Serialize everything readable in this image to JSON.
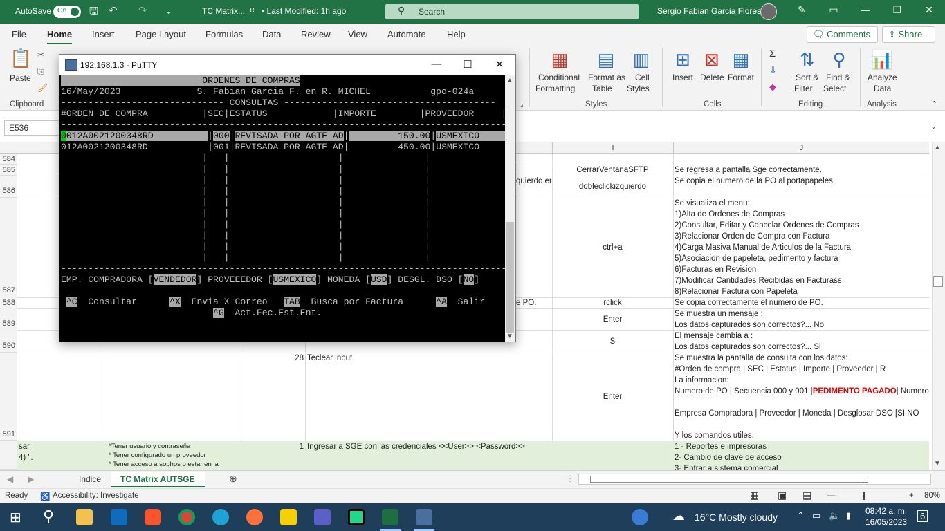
{
  "titlebar": {
    "autosave_label": "AutoSave",
    "autosave_state": "On",
    "doc_title": "TC Matrix...",
    "modified": "• Last Modified: 1h ago",
    "search_placeholder": "Search",
    "user": "Sergio Fabian Garcia Flores"
  },
  "tabs": [
    "File",
    "Home",
    "Insert",
    "Page Layout",
    "Formulas",
    "Data",
    "Review",
    "View",
    "Automate",
    "Help"
  ],
  "ribbon_buttons": {
    "comments": "Comments",
    "share": "Share"
  },
  "ribbon": {
    "paste": "Paste",
    "clipboard": "Clipboard",
    "cond_fmt_1": "Conditional",
    "cond_fmt_2": "Formatting",
    "format_table_1": "Format as",
    "format_table_2": "Table",
    "cell_styles_1": "Cell",
    "cell_styles_2": "Styles",
    "styles_group": "Styles",
    "insert": "Insert",
    "delete": "Delete",
    "format": "Format",
    "cells_group": "Cells",
    "sort_1": "Sort &",
    "sort_2": "Filter",
    "find_1": "Find &",
    "find_2": "Select",
    "editing_group": "Editing",
    "analyze_1": "Analyze",
    "analyze_2": "Data",
    "analysis_group": "Analysis"
  },
  "name_box": "E536",
  "grid": {
    "col_i": "I",
    "col_j": "J",
    "rows": {
      "r584": "584",
      "r585": "585",
      "r586": "586",
      "r587": "587",
      "r588": "588",
      "r589": "589",
      "r590": "590",
      "r591": "591"
    },
    "c585_i": "CerrarVentanaSFTP",
    "c585_j": "Se regresa a pantalla Sge correctamente.",
    "c586_h": "quierdo en",
    "c586_i": "dobleclickizquierdo",
    "c586_j": "Se copia el numero de la PO al portapapeles.",
    "c587_i": "ctrl+a",
    "c587_j": [
      "Se visualiza el menu:",
      "1)Alta de Ordenes de Compras",
      "2)Consultar, Editar y Cancelar Ordenes de Compras",
      "3)Relacionar Orden de Compra con Factura",
      "4)Carga Masiva Manual de Articulos de la Factura",
      "5)Asociacion de papeleta, pedimento y factura",
      "6)Facturas en Revision",
      "7)Modificar Cantidades Recibidas en Facturass",
      "8)Relacionar Factura con Papeleta"
    ],
    "c588_h": "e PO.",
    "c588_i": "rclick",
    "c588_j": "Se copia correctamente el numero de PO.",
    "c589_i": "Enter",
    "c589_j1": "Se muestra un mensaje :",
    "c589_j2": "Los datos capturados son correctos?... No",
    "c590_i": "S",
    "c590_j1": "El mensaje cambia a :",
    "c590_j2": "Los datos capturados son correctos?... Si",
    "c591_g": "28",
    "c591_h": "Teclear input",
    "c591_i": "Enter",
    "c591_j1": "Se muestra la pantalla de consulta con los datos:",
    "c591_j2": "#Orden de compra | SEC | Estatus | Importe | Proveedor | R",
    "c591_j3": "La informacion:",
    "c591_j4a": "Numero de PO | Secuencia 000 y 001 |",
    "c591_j4b": "PEDIMENTO PAGADO",
    "c591_j4c": "| Numero c",
    "c591_j5": "Empresa Compradora | Proveedor | Moneda | Desglosar DSO [SI NO",
    "c591_j6": "Y los comandos utiles.",
    "g_a1": "sar",
    "g_a2": "4) \".",
    "g_b1": "*Tener usuario y contraseña",
    "g_b2": "* Tener configurado un proveedor",
    "g_b3": "* Tener acceso a sophos o estar en la",
    "g_g": "1",
    "g_h": "Ingresar a SGE con las credenciales <<User>> <Password>>",
    "g_j1": "1 - Reportes e impresoras",
    "g_j2": "2- Cambio de clave de acceso",
    "g_j3": "3- Entrar a sistema comercial"
  },
  "sheets": {
    "tab1": "Indice",
    "tab2": "TC Matrix AUTSGE"
  },
  "status": {
    "ready": "Ready",
    "accessibility": "Accessibility: Investigate",
    "zoom": "80%"
  },
  "taskbar": {
    "weather": "16°C  Mostly cloudy",
    "time": "08:42 a. m.",
    "date": "16/05/2023",
    "notif": "6"
  },
  "putty": {
    "title": "192.168.1.3 - PuTTY",
    "l1": "                          ORDENES DE COMPRAS",
    "l2a": "16/May/2023              S. Fabian Garcia F. en R. MICHEL           gpo-024a",
    "l3": "------------------------------ CONSULTAS ---------------------------------------",
    "l4": "#ORDEN DE COMPRA          |SEC|ESTATUS            |IMPORTE        |PROVEEDOR     |R",
    "l5": "------------------------------------------------------------------------------------",
    "row1": {
      "po": "012A0021200348RD",
      "sec": "000",
      "status": "REVISADA POR AGTE AD",
      "importe": "150.00",
      "prov": "USMEXICO"
    },
    "row2": {
      "po": "012A0021200348RD",
      "sec": "001",
      "status": "REVISADA POR AGTE AD",
      "importe": "450.00",
      "prov": "USMEXICO"
    },
    "footer": {
      "emp_label": "EMP. COMPRADORA",
      "emp_val": "VENDEDOR",
      "prov_label": "PROVEEEDOR",
      "prov_val": "USMEXICO",
      "mon_label": "MONEDA",
      "mon_val": "USD",
      "dso_label": "DESGL. DSO",
      "dso_val": "NO"
    },
    "cmds": {
      "c1k": "^C",
      "c1": "Consultar",
      "c2k": "^X",
      "c2": "Envia X Correo",
      "c3k": "TAB",
      "c3": "Busca por Factura",
      "c4k": "^A",
      "c4": "Salir",
      "c5k": "^G",
      "c5": "Act.Fec.Est.Ent."
    }
  }
}
